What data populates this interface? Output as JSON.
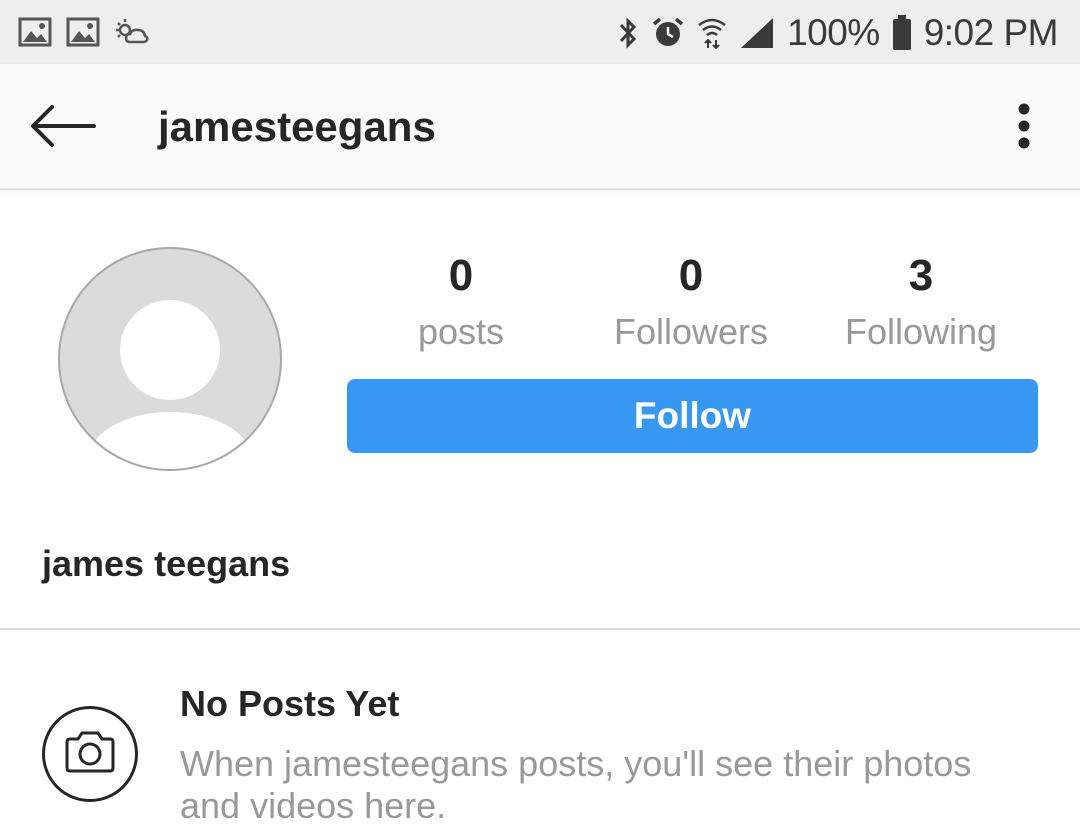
{
  "status_bar": {
    "left_icons": [
      "gallery-icon",
      "gallery-icon",
      "weather-icon"
    ],
    "right_icons": [
      "bluetooth-icon",
      "alarm-icon",
      "wifi-icon",
      "signal-icon",
      "battery-icon"
    ],
    "battery": "100%",
    "time": "9:02 PM"
  },
  "header": {
    "back_icon": "back-arrow-icon",
    "username": "jamesteegans",
    "menu_icon": "more-vertical-icon"
  },
  "profile": {
    "avatar_icon": "default-avatar-icon",
    "stats": [
      {
        "value": "0",
        "label": "posts"
      },
      {
        "value": "0",
        "label": "Followers"
      },
      {
        "value": "3",
        "label": "Following"
      }
    ],
    "follow_label": "Follow",
    "full_name": "james teegans"
  },
  "empty_state": {
    "icon": "camera-icon",
    "title": "No Posts Yet",
    "description": "When jamesteegans posts, you'll see their photos and videos here."
  },
  "colors": {
    "accent": "#3897f0",
    "text": "#262626",
    "muted": "#999999",
    "status_bar_bg": "#eeeeee",
    "header_bg": "#fafafa"
  }
}
